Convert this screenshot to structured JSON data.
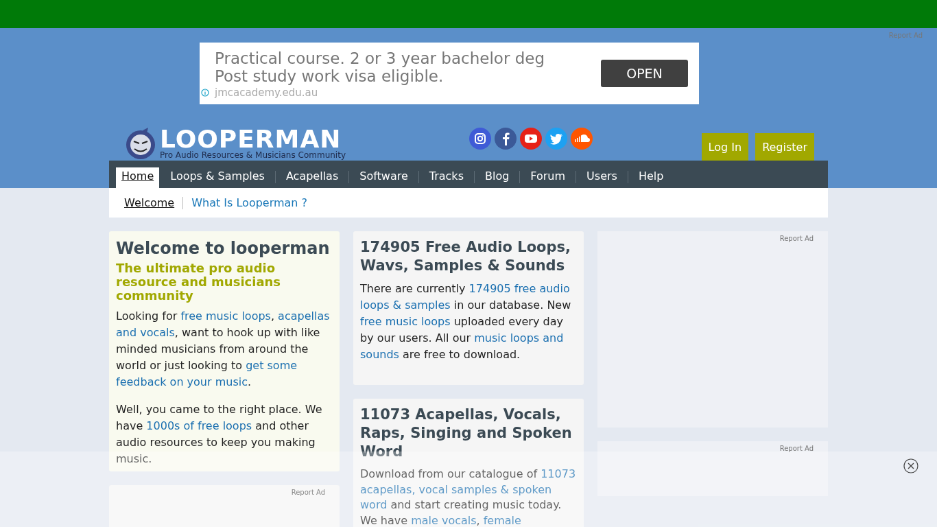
{
  "top_ad": {
    "report": "Report Ad",
    "lines": [
      "Practical course. 2 or 3 year bachelor deg",
      "Post study work visa eligible."
    ],
    "domain": "jmcacademy.edu.au",
    "button": "OPEN"
  },
  "logo": {
    "title": "LOOPERMAN",
    "tagline": "Pro Audio Resources & Musicians Community"
  },
  "auth_buttons": [
    "Log In",
    "Register"
  ],
  "nav": [
    {
      "label": "Home",
      "selected": true
    },
    {
      "label": "Loops & Samples",
      "selected": false
    },
    {
      "label": "Acapellas",
      "selected": false
    },
    {
      "label": "Software",
      "selected": false
    },
    {
      "label": "Tracks",
      "selected": false
    },
    {
      "label": "Blog",
      "selected": false
    },
    {
      "label": "Forum",
      "selected": false
    },
    {
      "label": "Users",
      "selected": false
    },
    {
      "label": "Help",
      "selected": false
    }
  ],
  "subnav": [
    {
      "label": "Welcome",
      "selected": true
    },
    {
      "label": "What Is Looperman ?",
      "selected": false
    }
  ],
  "welcome": {
    "title": "Welcome to looperman",
    "subtitle": "The ultimate pro audio resource and musicians community",
    "paragraphs": [
      [
        {
          "text": "Looking for "
        },
        {
          "text": "free music loops",
          "link": true
        },
        {
          "text": ", "
        },
        {
          "parts": [
            "acapellas",
            "and vocals"
          ],
          "link": true
        },
        {
          "text": ", want to hook up with like minded musicians from around the world or just looking to "
        },
        {
          "parts": [
            "get some",
            "feedback on your music"
          ],
          "link": true
        },
        {
          "text": "."
        }
      ],
      [
        {
          "text": "Well, you came to the right place. We have "
        },
        {
          "text": "1000s of free loops",
          "link": true
        },
        {
          "text": " and other audio resources to keep you making music."
        }
      ]
    ]
  },
  "cards": [
    {
      "title": "174905 Free Audio Loops, Wavs, Samples & Sounds",
      "paragraph": [
        {
          "text": "There are currently "
        },
        {
          "parts": [
            "174905 free audio",
            "loops & samples"
          ],
          "link": true
        },
        {
          "text": " in our database. New "
        },
        {
          "text": "free music loops",
          "link": true
        },
        {
          "text": " uploaded every day by our users. All our "
        },
        {
          "parts": [
            "music loops and",
            "sounds"
          ],
          "link": true
        },
        {
          "text": " are free to download."
        }
      ]
    },
    {
      "title": "11073 Acapellas, Vocals, Raps, Singing and Spoken Word",
      "paragraph": [
        {
          "text": "Download from our catalogue of "
        },
        {
          "parts": [
            "11073",
            "acapellas, vocal samples & spoken",
            "word"
          ],
          "link": true
        },
        {
          "text": " and start creating music today. We have "
        },
        {
          "text": "male vocals",
          "link": true
        },
        {
          "text": ", "
        },
        {
          "text": "female",
          "link": true
        }
      ]
    }
  ],
  "side_ads": [
    {
      "report": "Report Ad"
    },
    {
      "report": "Report Ad"
    }
  ],
  "bottom_ad": {
    "report": "Report Ad"
  }
}
